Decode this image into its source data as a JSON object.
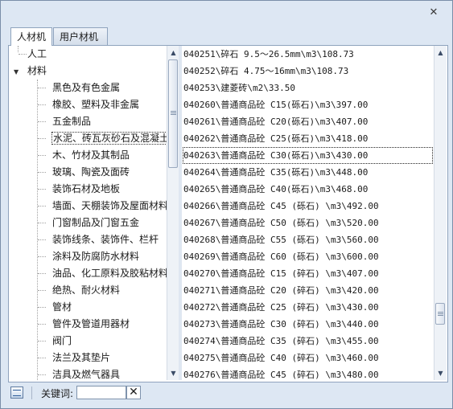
{
  "window": {
    "close_icon": "close-icon"
  },
  "tabs": [
    {
      "label": "人材机"
    },
    {
      "label": "用户材机"
    }
  ],
  "tree": {
    "top_item": "人工",
    "root_item": "材料",
    "children": [
      "黑色及有色金属",
      "橡胶、塑料及非金属",
      "五金制品",
      "水泥、砖瓦灰砂石及混凝土",
      "木、竹材及其制品",
      "玻璃、陶瓷及面砖",
      "装饰石材及地板",
      "墙面、天棚装饰及屋面材料",
      "门窗制品及门窗五金",
      "装饰线条、装饰件、栏杆",
      "涂料及防腐防水材料",
      "油品、化工原料及胶粘材料",
      "绝热、耐火材料",
      "管材",
      "管件及管道用器材",
      "阀门",
      "法兰及其垫片",
      "洁具及燃气器具"
    ],
    "selected_index": 3
  },
  "list": {
    "items": [
      "040251\\碎石 9.5～26.5mm\\m3\\108.73",
      "040252\\碎石 4.75～16mm\\m3\\108.73",
      "040253\\建菱砖\\m2\\33.50",
      "040260\\普通商品砼 C15(砾石)\\m3\\397.00",
      "040261\\普通商品砼 C20(砾石)\\m3\\407.00",
      "040262\\普通商品砼 C25(砾石)\\m3\\418.00",
      "040263\\普通商品砼 C30(砾石)\\m3\\430.00",
      "040264\\普通商品砼 C35(砾石)\\m3\\448.00",
      "040265\\普通商品砼 C40(砾石)\\m3\\468.00",
      "040266\\普通商品砼 C45 (砾石) \\m3\\492.00",
      "040267\\普通商品砼 C50 (砾石) \\m3\\520.00",
      "040268\\普通商品砼 C55 (砾石) \\m3\\560.00",
      "040269\\普通商品砼 C60 (砾石) \\m3\\600.00",
      "040270\\普通商品砼 C15 (碎石) \\m3\\407.00",
      "040271\\普通商品砼 C20 (碎石) \\m3\\420.00",
      "040272\\普通商品砼 C25 (碎石) \\m3\\430.00",
      "040273\\普通商品砼 C30 (碎石) \\m3\\440.00",
      "040274\\普通商品砼 C35 (碎石) \\m3\\455.00",
      "040275\\普通商品砼 C40 (碎石) \\m3\\460.00",
      "040276\\普通商品砼 C45 (碎石) \\m3\\480.00"
    ],
    "selected_index": 6
  },
  "footer": {
    "keyword_label": "关键词:",
    "keyword_value": "",
    "clear_icon": "clear-icon"
  }
}
